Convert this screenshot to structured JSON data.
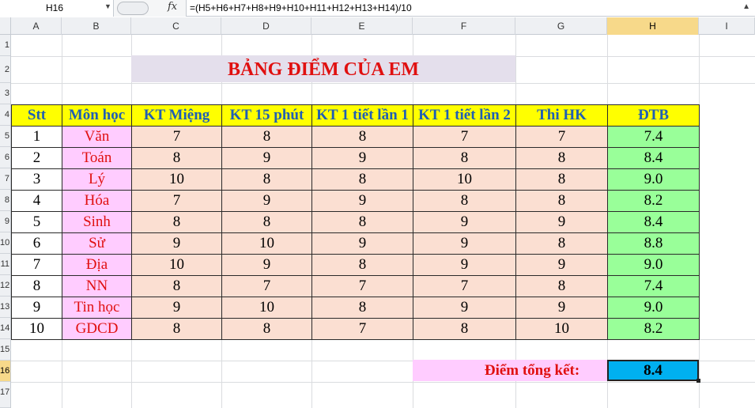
{
  "namebox": {
    "cell": "H16"
  },
  "formula_bar": {
    "formula": "=(H5+H6+H7+H8+H9+H10+H11+H12+H13+H14)/10"
  },
  "columns": [
    "A",
    "B",
    "C",
    "D",
    "E",
    "F",
    "G",
    "H",
    "I"
  ],
  "rows": [
    "1",
    "2",
    "3",
    "4",
    "5",
    "6",
    "7",
    "8",
    "9",
    "10",
    "11",
    "12",
    "13",
    "14",
    "15",
    "16",
    "17"
  ],
  "sheet": {
    "title": "BẢNG ĐIỂM CỦA EM",
    "headers": [
      "Stt",
      "Môn học",
      "KT Miệng",
      "KT 15 phút",
      "KT 1 tiết lần 1",
      "KT 1 tiết lần 2",
      "Thi HK",
      "ĐTB"
    ],
    "rows": [
      [
        "1",
        "Văn",
        "7",
        "8",
        "8",
        "7",
        "7",
        "7.4"
      ],
      [
        "2",
        "Toán",
        "8",
        "9",
        "9",
        "8",
        "8",
        "8.4"
      ],
      [
        "3",
        "Lý",
        "10",
        "8",
        "8",
        "10",
        "8",
        "9.0"
      ],
      [
        "4",
        "Hóa",
        "7",
        "9",
        "9",
        "8",
        "8",
        "8.2"
      ],
      [
        "5",
        "Sinh",
        "8",
        "8",
        "8",
        "9",
        "9",
        "8.4"
      ],
      [
        "6",
        "Sử",
        "9",
        "10",
        "9",
        "9",
        "8",
        "8.8"
      ],
      [
        "7",
        "Địa",
        "10",
        "9",
        "8",
        "9",
        "9",
        "9.0"
      ],
      [
        "8",
        "NN",
        "8",
        "7",
        "7",
        "7",
        "8",
        "7.4"
      ],
      [
        "9",
        "Tin học",
        "9",
        "10",
        "8",
        "9",
        "9",
        "9.0"
      ],
      [
        "10",
        "GDCD",
        "8",
        "8",
        "7",
        "8",
        "10",
        "8.2"
      ]
    ],
    "total_label": "Điểm tổng kết:",
    "total_value": "8.4"
  },
  "selected": {
    "column": "H",
    "row": "16"
  }
}
